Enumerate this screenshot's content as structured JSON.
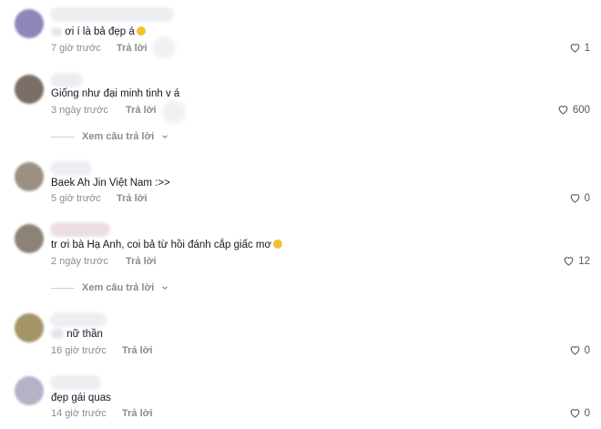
{
  "comments": [
    {
      "username": "",
      "text": "ơi í là bả đẹp á",
      "time": "7 giờ trước",
      "reply": "Trả lời",
      "likes": "1",
      "avatar_color": "#8f86b8"
    },
    {
      "username": "",
      "text": "Giống như đại minh tinh v á",
      "time": "3 ngày trước",
      "reply": "Trả lời",
      "likes": "600",
      "avatar_color": "#7a6e66"
    },
    {
      "username": "",
      "text": "Baek Ah Jin Việt Nam :>>",
      "time": "5 giờ trước",
      "reply": "Trả lời",
      "likes": "0",
      "avatar_color": "#9c9082"
    },
    {
      "username": "",
      "text": "tr ơi bà Hạ Anh, coi bả từ hồi đánh cắp giấc mơ",
      "time": "2 ngày trước",
      "reply": "Trả lời",
      "likes": "12",
      "avatar_color": "#8d8278"
    },
    {
      "username": "",
      "text": "nữ thần",
      "time": "16 giờ trước",
      "reply": "Trả lời",
      "likes": "0",
      "avatar_color": "#a49566"
    },
    {
      "username": "",
      "text": "đẹp gái quas",
      "time": "14 giờ trước",
      "reply": "Trả lời",
      "likes": "0",
      "avatar_color": "#b5b2c8"
    }
  ],
  "view_replies_label": "Xem câu trả lời",
  "icons": {
    "like": "heart-icon",
    "expand": "chevron-down-icon"
  }
}
